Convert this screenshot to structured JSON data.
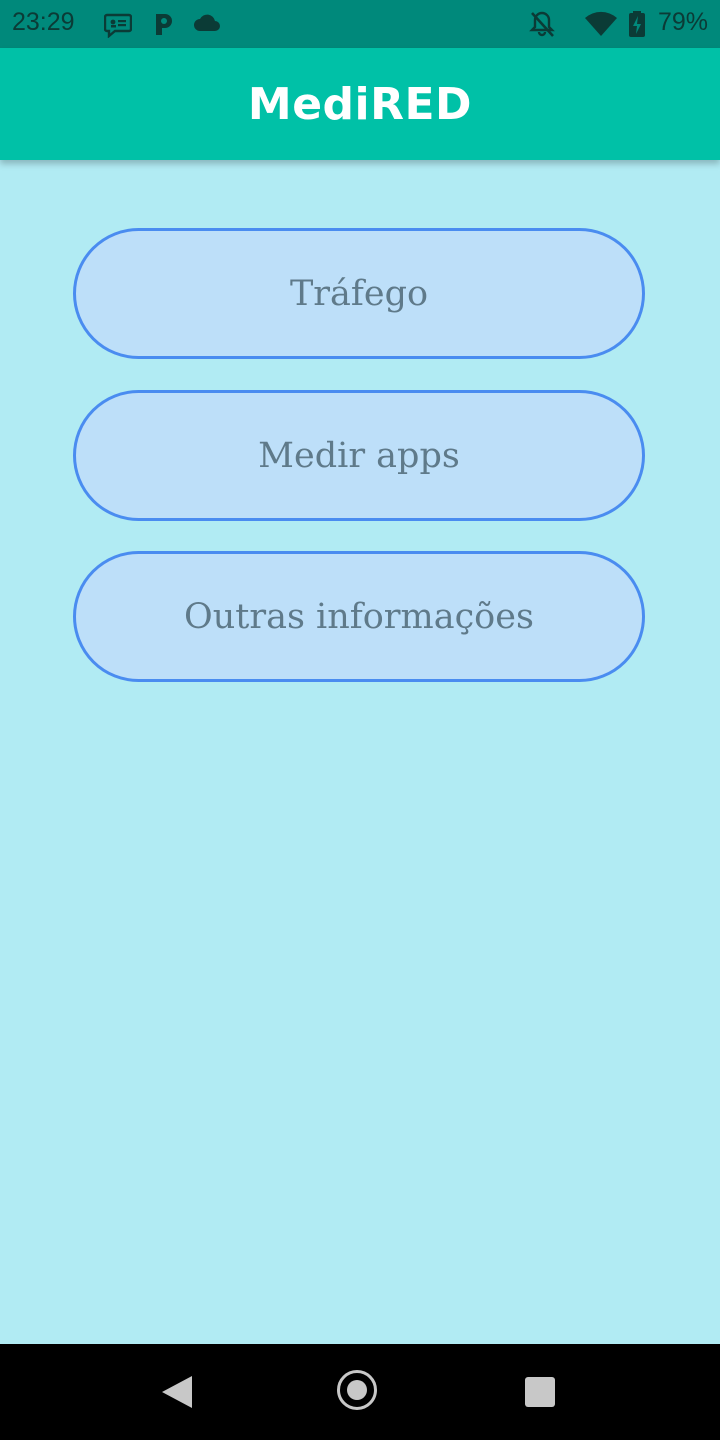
{
  "status_bar": {
    "time": "23:29",
    "battery": "79%",
    "icons": [
      "message-icon",
      "parking-icon",
      "cloud-icon",
      "notifications-off-icon",
      "wifi-icon",
      "battery-charging-icon"
    ],
    "background_color": "#00897b"
  },
  "app_bar": {
    "title": "MediRED",
    "background_color": "#00c1a7"
  },
  "menu": {
    "buttons": [
      {
        "label": "Tráfego"
      },
      {
        "label": "Medir apps"
      },
      {
        "label": "Outras informações"
      }
    ],
    "button_fill_color": "#bddff9",
    "button_border_color": "#4a8cf0",
    "button_text_color": "#5f7a8a"
  },
  "page": {
    "background_color": "#b1ebf3"
  },
  "nav_bar": {
    "icons": [
      "back-icon",
      "home-icon",
      "recents-icon"
    ]
  }
}
